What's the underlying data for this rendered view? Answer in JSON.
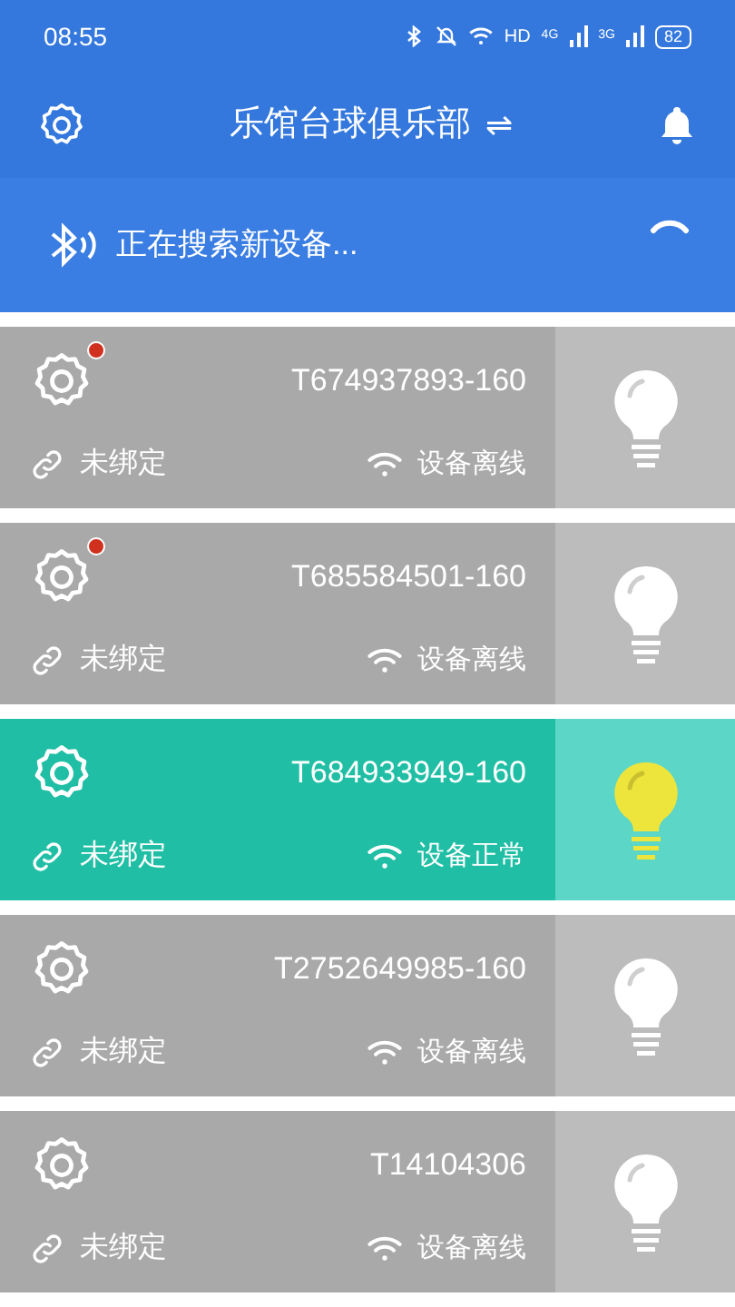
{
  "status_bar": {
    "time": "08:55",
    "network": "HD",
    "sim1": "4G",
    "sim2": "3G",
    "battery": "82"
  },
  "header": {
    "title": "乐馆台球俱乐部",
    "switch_glyph": "⇌"
  },
  "scan_bar": {
    "text": "正在搜索新设备..."
  },
  "devices": [
    {
      "id": "T674937893-160",
      "binding": "未绑定",
      "status": "设备离线",
      "online": false,
      "alert": true
    },
    {
      "id": "T685584501-160",
      "binding": "未绑定",
      "status": "设备离线",
      "online": false,
      "alert": true
    },
    {
      "id": "T684933949-160",
      "binding": "未绑定",
      "status": "设备正常",
      "online": true,
      "alert": false
    },
    {
      "id": "T2752649985-160",
      "binding": "未绑定",
      "status": "设备离线",
      "online": false,
      "alert": false
    },
    {
      "id": "T14104306",
      "binding": "未绑定",
      "status": "设备离线",
      "online": false,
      "alert": false
    }
  ]
}
